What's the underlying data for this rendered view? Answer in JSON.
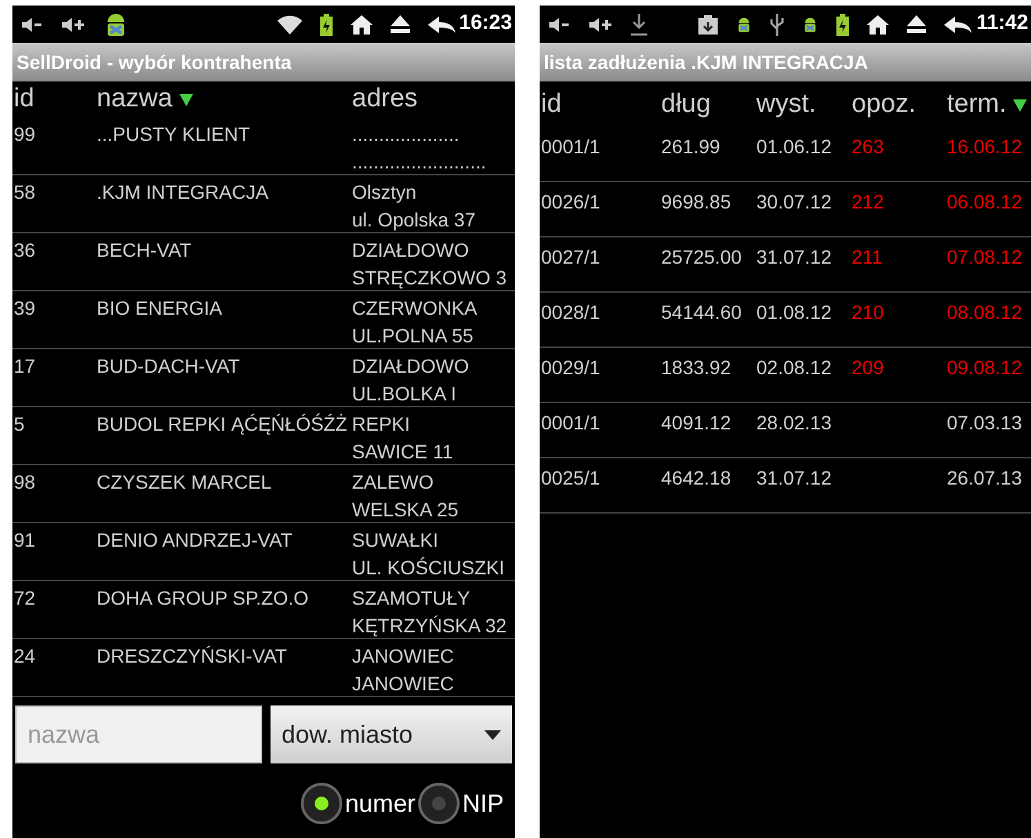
{
  "left_screen": {
    "status_bar": {
      "time": "16:23"
    },
    "title": "SellDroid - wybór kontrahenta",
    "columns": [
      {
        "label": "id",
        "sorted": false
      },
      {
        "label": "nazwa",
        "sorted": true
      },
      {
        "label": "adres",
        "sorted": false
      }
    ],
    "rows": [
      {
        "id": "99",
        "name": "...PUSTY KLIENT",
        "address": [
          "....................",
          "........................."
        ]
      },
      {
        "id": "58",
        "name": ".KJM INTEGRACJA",
        "address": [
          "Olsztyn",
          "ul. Opolska 37"
        ]
      },
      {
        "id": "36",
        "name": "BECH-VAT",
        "address": [
          "DZIAŁDOWO",
          "STRĘCZKOWO 3"
        ]
      },
      {
        "id": "39",
        "name": "BIO ENERGIA",
        "address": [
          "CZERWONKA",
          "UL.POLNA 55"
        ]
      },
      {
        "id": "17",
        "name": "BUD-DACH-VAT",
        "address": [
          "DZIAŁDOWO",
          "UL.BOLKA I"
        ]
      },
      {
        "id": "5",
        "name": "BUDOL REPKI ĄĆĘŃŁÓŚŹŻ",
        "address": [
          "REPKI",
          "SAWICE 11"
        ]
      },
      {
        "id": "98",
        "name": "CZYSZEK MARCEL",
        "address": [
          "ZALEWO",
          "WELSKA 25"
        ]
      },
      {
        "id": "91",
        "name": "DENIO ANDRZEJ-VAT",
        "address": [
          "SUWAŁKI",
          "UL. KOŚCIUSZKI"
        ]
      },
      {
        "id": "72",
        "name": "DOHA GROUP SP.ZO.O",
        "address": [
          "SZAMOTUŁY",
          "KĘTRZYŃSKA 32"
        ]
      },
      {
        "id": "24",
        "name": "DRESZCZYŃSKI-VAT",
        "address": [
          "JANOWIEC",
          "JANOWIEC"
        ]
      }
    ],
    "search_field": {
      "placeholder": "nazwa"
    },
    "dropdown": {
      "value": "dow. miasto"
    },
    "radios": [
      {
        "label": "numer",
        "selected": true
      },
      {
        "label": "NIP",
        "selected": false
      }
    ]
  },
  "right_screen": {
    "status_bar": {
      "time": "11:42"
    },
    "title": "lista zadłużenia .KJM INTEGRACJA",
    "columns": [
      {
        "label": "id",
        "sorted": false
      },
      {
        "label": "dług",
        "sorted": false
      },
      {
        "label": "wyst.",
        "sorted": false
      },
      {
        "label": "opoz.",
        "sorted": false
      },
      {
        "label": "term.",
        "sorted": true
      }
    ],
    "rows": [
      {
        "id": "0001/1",
        "debt": "261.99",
        "issued": "01.06.12",
        "delay": "263",
        "due": "16.06.12",
        "overdue": true
      },
      {
        "id": "0026/1",
        "debt": "9698.85",
        "issued": "30.07.12",
        "delay": "212",
        "due": "06.08.12",
        "overdue": true
      },
      {
        "id": "0027/1",
        "debt": "25725.00",
        "issued": "31.07.12",
        "delay": "211",
        "due": "07.08.12",
        "overdue": true
      },
      {
        "id": "0028/1",
        "debt": "54144.60",
        "issued": "01.08.12",
        "delay": "210",
        "due": "08.08.12",
        "overdue": true
      },
      {
        "id": "0029/1",
        "debt": "1833.92",
        "issued": "02.08.12",
        "delay": "209",
        "due": "09.08.12",
        "overdue": true
      },
      {
        "id": "0001/1",
        "debt": "4091.12",
        "issued": "28.02.13",
        "due": "07.03.13",
        "overdue": false
      },
      {
        "id": "0025/1",
        "debt": "4642.18",
        "issued": "31.07.12",
        "due": "26.07.13",
        "overdue": false
      }
    ]
  }
}
